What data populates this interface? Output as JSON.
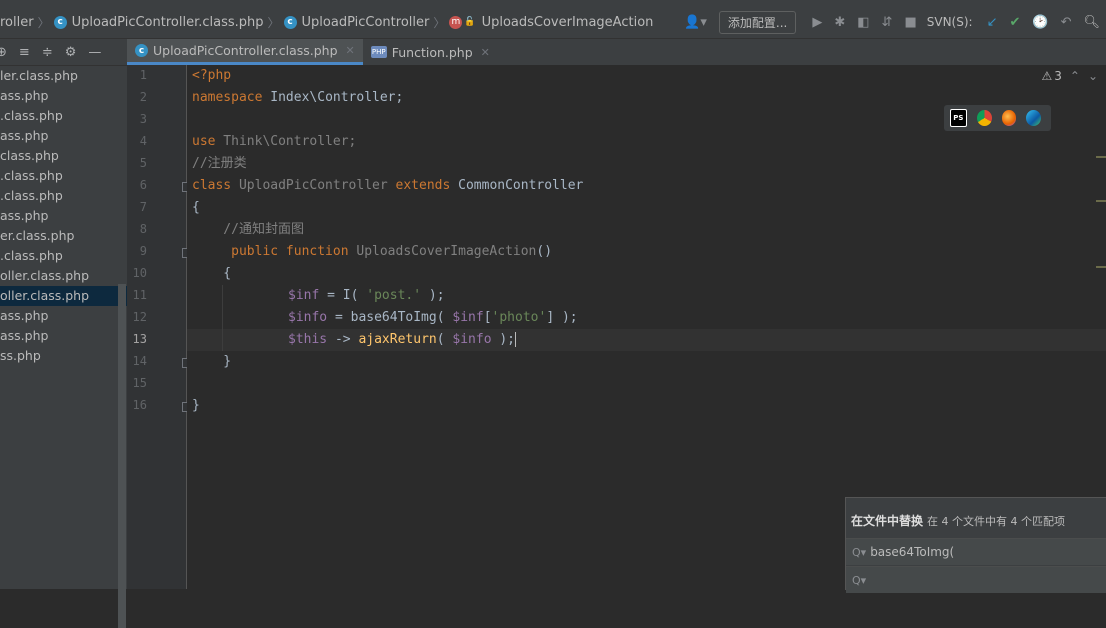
{
  "navbar": {
    "crumbs": [
      "roller",
      "UploadPicController.class.php",
      "UploadPicController",
      "UploadsCoverImageAction"
    ],
    "config_button": "添加配置...",
    "svn_label": "SVN(S):"
  },
  "project": {
    "files": [
      "ler.class.php",
      "ass.php",
      ".class.php",
      "ass.php",
      "class.php",
      ".class.php",
      ".class.php",
      "ass.php",
      "er.class.php",
      ".class.php",
      "oller.class.php",
      "oller.class.php",
      "ass.php",
      "ass.php",
      "ss.php"
    ],
    "selected_index": 11
  },
  "tabs": [
    {
      "label": "UploadPicController.class.php",
      "active": true
    },
    {
      "label": "Function.php",
      "active": false
    }
  ],
  "editor": {
    "line_numbers": [
      "1",
      "2",
      "3",
      "4",
      "5",
      "6",
      "7",
      "8",
      "9",
      "10",
      "11",
      "12",
      "13",
      "14",
      "15",
      "16"
    ],
    "current_line": 13,
    "warning_count": "3",
    "code": {
      "l1": "<?php",
      "l2_kw": "namespace",
      "l2_rest": " Index\\Controller;",
      "l4_kw": "use",
      "l4_rest": " Think\\Controller;",
      "l5": "//注册类",
      "l6_kw": "class",
      "l6_name": " UploadPicController ",
      "l6_ext": "extends",
      "l6_parent": " CommonController",
      "l7": "{",
      "l8": "    //通知封面图",
      "l9_kw1": "     public",
      "l9_kw2": " function",
      "l9_name": " UploadsCoverImageAction",
      "l9_rest": "()",
      "l10": "    {",
      "l11_var": "$inf",
      "l11_rest1": " = I( ",
      "l11_str": "'post.'",
      "l11_rest2": " );",
      "l12_var": "$info",
      "l12_rest1": " = base64ToImg( ",
      "l12_var2": "$inf",
      "l12_rest2": "[",
      "l12_str": "'photo'",
      "l12_rest3": "] );",
      "l13_var": "$this",
      "l13_rest1": " -> ",
      "l13_fn": "ajaxReturn",
      "l13_rest2": "( ",
      "l13_var2": "$info",
      "l13_rest3": " );",
      "l14": "    }",
      "l16": "}"
    }
  },
  "find_panel": {
    "title": "在文件中替换",
    "summary": "在 4 个文件中有 4 个匹配项",
    "search_value": "base64ToImg(",
    "replace_value": ""
  },
  "colors": {
    "keyword": "#cc7832",
    "string": "#6a8759",
    "variable": "#9876aa",
    "function": "#ffc66d",
    "accent": "#4a88c7"
  }
}
